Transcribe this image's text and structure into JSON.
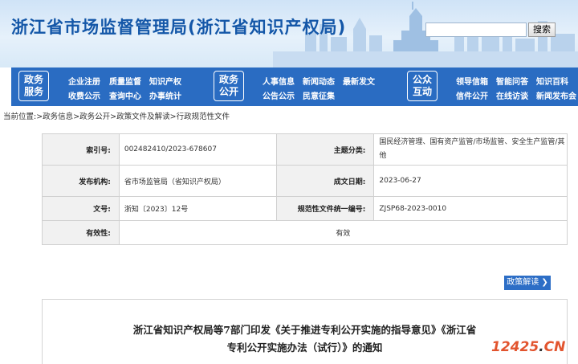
{
  "header": {
    "site_title": "浙江省市场监督管理局(浙江省知识产权局)",
    "search_placeholder": "",
    "search_button": "搜索"
  },
  "nav": {
    "groups": [
      {
        "badge_line1": "政务",
        "badge_line2": "服务",
        "links": [
          "企业注册",
          "质量监督",
          "知识产权",
          "收费公示",
          "查询中心",
          "办事统计"
        ]
      },
      {
        "badge_line1": "政务",
        "badge_line2": "公开",
        "links": [
          "人事信息",
          "新闻动态",
          "最新发文",
          "公告公示",
          "民意征集"
        ]
      },
      {
        "badge_line1": "公众",
        "badge_line2": "互动",
        "links": [
          "领导信箱",
          "智能问答",
          "知识百科",
          "信件公开",
          "在线访谈",
          "新闻发布会"
        ]
      }
    ]
  },
  "breadcrumb": {
    "prefix": "当前位置:",
    "items": [
      "政务信息",
      "政务公开",
      "政策文件及解读",
      "行政规范性文件"
    ],
    "separator": ">"
  },
  "info": {
    "index_label": "索引号:",
    "index_value": "002482410/2023-678607",
    "topic_label": "主题分类:",
    "topic_value": "国民经济管理、国有资产监管/市场监管、安全生产监管/其他",
    "issuer_label": "发布机构:",
    "issuer_value": "省市场监管局（省知识产权局）",
    "date_label": "成文日期:",
    "date_value": "2023-06-27",
    "docno_label": "文号:",
    "docno_value": "浙知〔2023〕12号",
    "normno_label": "规范性文件统一编号:",
    "normno_value": "ZJSP68-2023-0010",
    "valid_label": "有效性:",
    "valid_value": "有效"
  },
  "interpretation_button": "政策解读",
  "document": {
    "title_line1": "浙江省知识产权局等7部门印发《关于推进专利公开实施的指导意见》《浙江省",
    "title_line2": "专利公开实施办法（试行）》的通知"
  },
  "watermark": {
    "text": "12425",
    "suffix": "CN",
    "dot": "."
  }
}
